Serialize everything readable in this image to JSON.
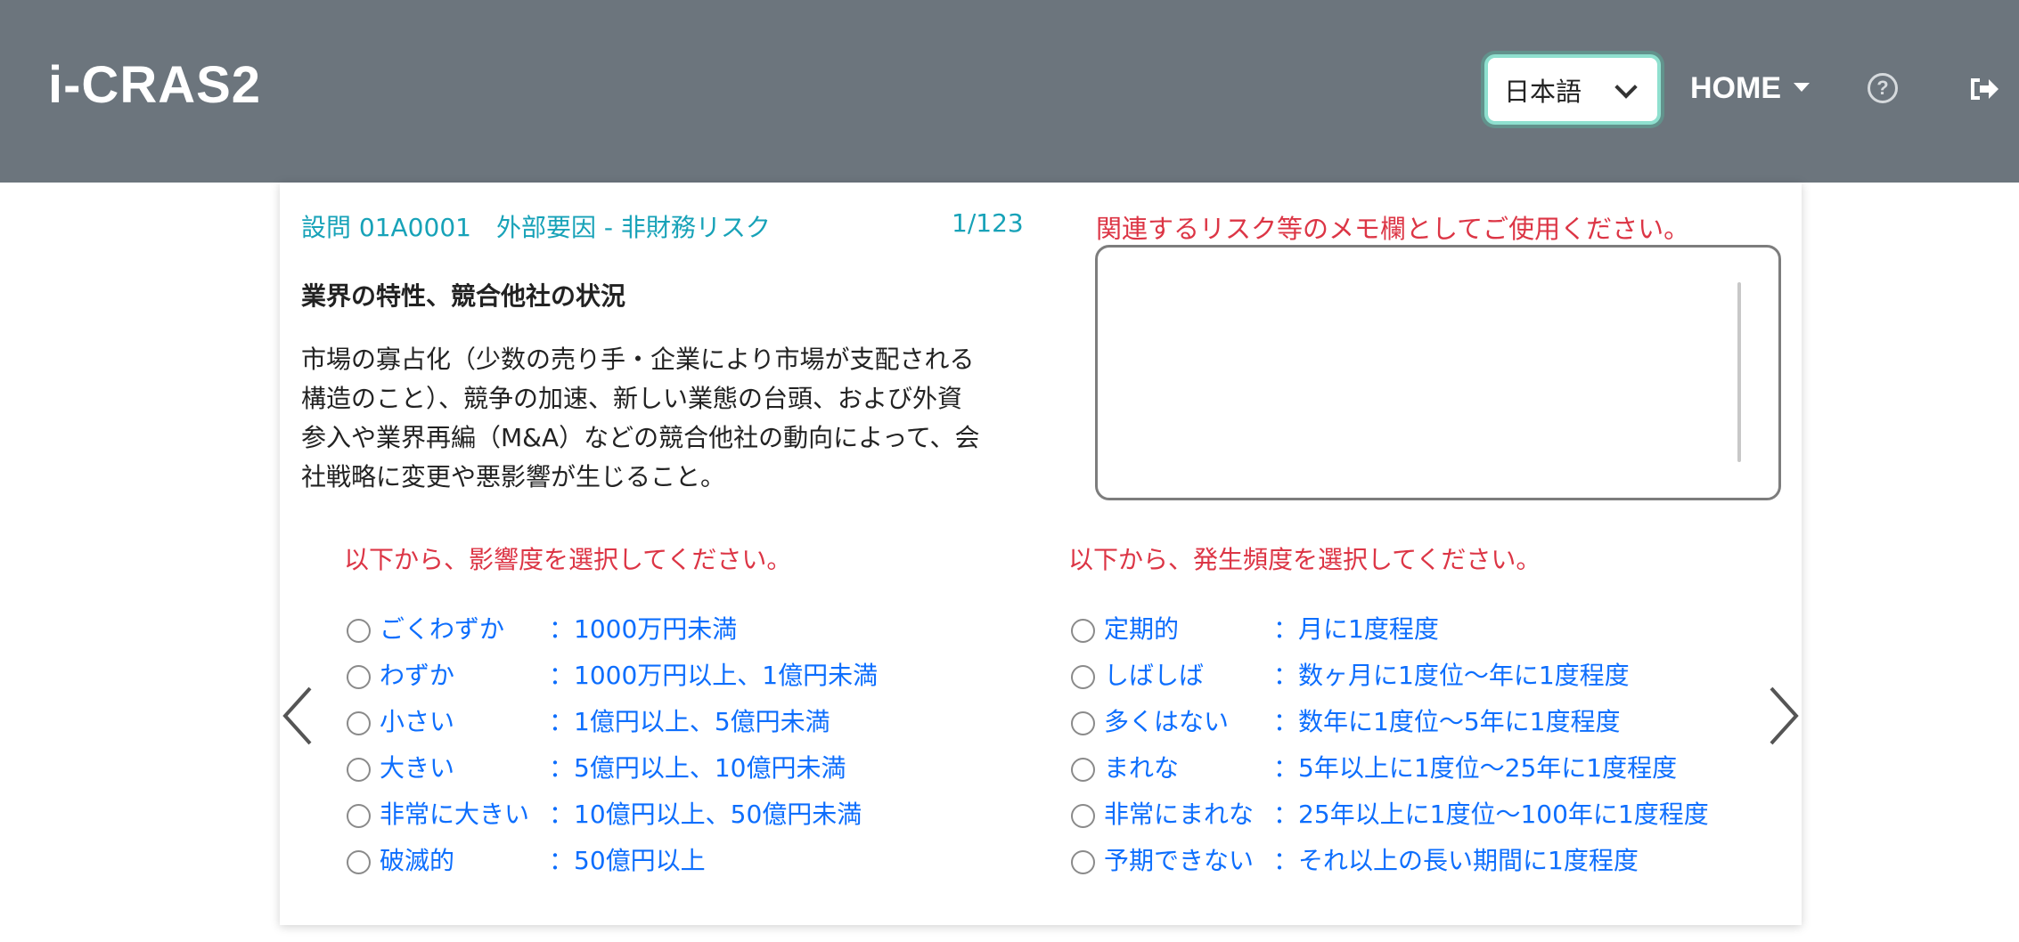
{
  "header": {
    "brand": "i-CRAS2",
    "language": "日本語",
    "home_label": "HOME"
  },
  "question": {
    "header": "設問 01A0001　外部要因 - 非財務リスク",
    "counter": "1/123",
    "title": "業界の特性、競合他社の状況",
    "body_lines": [
      "市場の寡占化（少数の売り手・企業により市場が支配される",
      "構造のこと）、競争の加速、新しい業態の台頭、および外資",
      "参入や業界再編（M&A）などの競合他社の動向によって、会",
      "社戦略に変更や悪影響が生じること。"
    ]
  },
  "memo": {
    "label": "関連するリスク等のメモ欄としてご使用ください。",
    "value": ""
  },
  "impact": {
    "label": "以下から、影響度を選択してください。",
    "options": [
      {
        "name": "ごくわずか",
        "desc": "：1000万円未満"
      },
      {
        "name": "わずか",
        "desc": "：1000万円以上、1億円未満"
      },
      {
        "name": "小さい",
        "desc": "：1億円以上、5億円未満"
      },
      {
        "name": "大きい",
        "desc": "：5億円以上、10億円未満"
      },
      {
        "name": "非常に大きい",
        "desc": "：10億円以上、50億円未満"
      },
      {
        "name": "破滅的",
        "desc": "：50億円以上"
      }
    ]
  },
  "frequency": {
    "label": "以下から、発生頻度を選択してください。",
    "options": [
      {
        "name": "定期的",
        "desc": "：月に1度程度"
      },
      {
        "name": "しばしば",
        "desc": "：数ヶ月に1度位〜年に1度程度"
      },
      {
        "name": "多くはない",
        "desc": "：数年に1度位〜5年に1度程度"
      },
      {
        "name": "まれな",
        "desc": "：5年以上に1度位〜25年に1度程度"
      },
      {
        "name": "非常にまれな",
        "desc": "：25年以上に1度位〜100年に1度程度"
      },
      {
        "name": "予期できない",
        "desc": "：それ以上の長い期間に1度程度"
      }
    ]
  },
  "colors": {
    "navbar": "#6c757d",
    "question_header": "#17a2b8",
    "instruction": "#dc3545",
    "option_text": "#0d6efd"
  }
}
